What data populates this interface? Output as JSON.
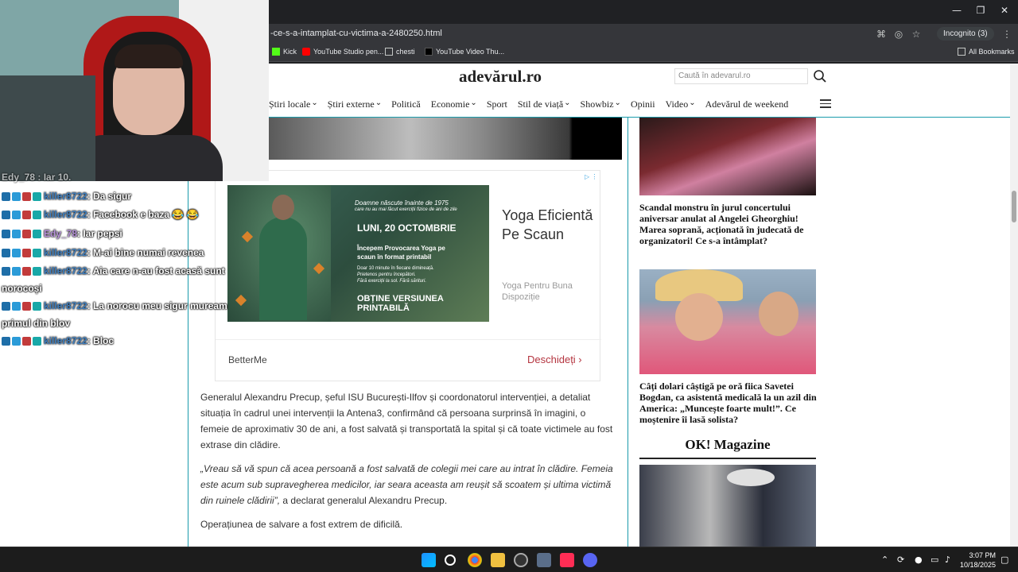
{
  "window": {
    "minimize": "—",
    "restore": "❐",
    "close": "✕"
  },
  "address": {
    "url": "-ce-s-a-intamplat-cu-victima-a-2480250.html",
    "incognito": "Incognito (3)"
  },
  "bookmarks": [
    {
      "label": "Kick",
      "color": "#53fc18"
    },
    {
      "label": "YouTube Studio pen...",
      "color": "#ff0000"
    },
    {
      "label": "chesti",
      "color": "#c4c7c5"
    },
    {
      "label": "YouTube Video Thu...",
      "color": "#000000"
    }
  ],
  "all_bookmarks": "All Bookmarks",
  "site": {
    "logo": "adevărul.ro",
    "search_placeholder": "Caută în adevarul.ro",
    "nav": [
      "Știri locale",
      "Știri externe",
      "Politică",
      "Economie",
      "Sport",
      "Stil de viață",
      "Showbiz",
      "Opinii",
      "Video",
      "Adevărul de weekend"
    ],
    "nav_dropdown": [
      true,
      true,
      false,
      true,
      false,
      true,
      true,
      false,
      true,
      false
    ]
  },
  "ad": {
    "img_line1": "Doamne născute înainte de 1975",
    "img_line2": "care nu au mai făcut exerciții fizice de ani de zile",
    "img_date": "LUNI, 20 OCTOMBRIE",
    "img_line3": "Începem Provocarea Yoga pe",
    "img_line4": "scaun în format printabil",
    "img_line5": "Doar 10 minute în fiecare dimineață.",
    "img_line6": "Prietenos pentru începători.",
    "img_line7": "Fără exerciții la sol. Fără sărituri.",
    "img_cta": "OBȚINE VERSIUNEA PRINTABILĂ",
    "title": "Yoga Eficientă Pe Scaun",
    "subtitle": "Yoga Pentru Buna Dispoziție",
    "brand": "BetterMe",
    "cta": "Deschideți ›"
  },
  "article": {
    "p1": "Generalul Alexandru Precup, șeful ISU București-Ilfov și coordonatorul intervenției, a detaliat situația în cadrul unei intervenții la Antena3, confirmând că persoana surprinsă în imagini, o femeie de aproximativ 30 de ani, a fost salvată și transportată la spital și că toate victimele au fost extrase din clădire.",
    "p2_quote": "„Vreau să vă spun că acea persoană a fost salvată de colegii mei care au intrat în clădire. Femeia este acum sub supravegherea medicilor, iar seara aceasta am reușit să scoatem și ultima victimă din ruinele clădirii”,",
    "p2_tail": " a declarat generalul Alexandru Precup.",
    "p3": "Operațiunea de salvare a fost extrem de dificilă."
  },
  "sidebar": {
    "story1": "Scandal monstru în jurul concertului aniversar anulat al Angelei Gheorghiu! Marea soprană, acționată în judecată de organizatori! Ce s-a întâmplat?",
    "story2": "Câți dolari câștigă pe oră fiica Savetei Bogdan, ca asistentă medicală la un azil din America: „Muncește foarte mult!”. Ce moștenire îi lasă solista?",
    "section": "OK! Magazine"
  },
  "chat": [
    {
      "user": "killer8722",
      "msg": ": Da sigur",
      "cls": "chat-user"
    },
    {
      "user": "killer8722",
      "msg": ": Facebook e baza 😂 😂",
      "cls": "chat-user"
    },
    {
      "user": "Edy_78",
      "msg": ": Iar pepsi",
      "cls": "chat-user2"
    },
    {
      "user": "killer8722",
      "msg": ": M-ai bine numai revenea",
      "cls": "chat-user"
    },
    {
      "user": "killer8722",
      "msg": ": Aia care n-au fost acasă sunt",
      "cls": "chat-user",
      "cont": "norocoși"
    },
    {
      "user": "killer8722",
      "msg": ": La norocu meu sigur muream",
      "cls": "chat-user",
      "cont": "primul din blov"
    },
    {
      "user": "killer8722",
      "msg": ": Bloc",
      "cls": "chat-user"
    }
  ],
  "chat_partial_top": "Edy_78 : Iar 10.",
  "taskbar": {
    "time": "3:07 PM",
    "date": "10/18/2025"
  }
}
